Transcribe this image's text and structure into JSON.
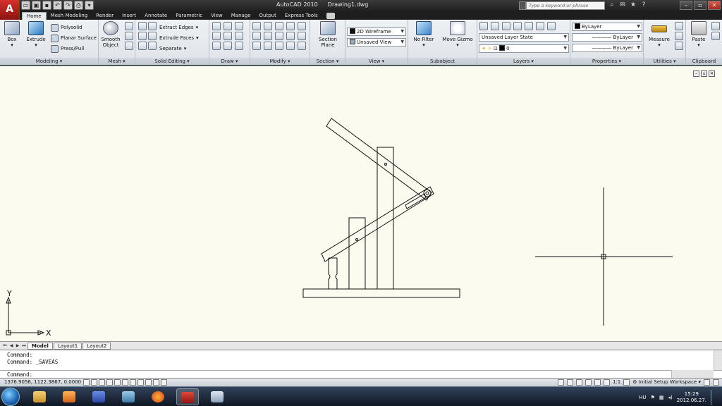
{
  "title": {
    "app_name": "AutoCAD 2010",
    "document": "Drawing1.dwg",
    "search_placeholder": "Type a keyword or phrase"
  },
  "tabs": [
    "Home",
    "Mesh Modeling",
    "Render",
    "Insert",
    "Annotate",
    "Parametric",
    "View",
    "Manage",
    "Output",
    "Express Tools"
  ],
  "ribbon": {
    "modeling": {
      "title": "Modeling",
      "box": "Box",
      "extrude": "Extrude",
      "polysolid": "Polysolid",
      "planar_surface": "Planar Surface",
      "press_pull": "Press/Pull"
    },
    "mesh": {
      "title": "Mesh",
      "smooth_object_1": "Smooth",
      "smooth_object_2": "Object"
    },
    "solid_editing": {
      "title": "Solid Editing",
      "extract_edges": "Extract Edges",
      "extrude_faces": "Extrude Faces",
      "separate": "Separate"
    },
    "draw": {
      "title": "Draw"
    },
    "modify": {
      "title": "Modify"
    },
    "section": {
      "title": "Section",
      "section_plane_1": "Section",
      "section_plane_2": "Plane"
    },
    "view": {
      "title": "View",
      "visual_style": "2D Wireframe",
      "named_view": "Unsaved View"
    },
    "subobject": {
      "title": "Subobject",
      "no_filter": "No Filter",
      "move_gizmo": "Move Gizmo"
    },
    "layers": {
      "title": "Layers",
      "layer_state": "Unsaved Layer State",
      "current_layer": "0"
    },
    "properties": {
      "title": "Properties",
      "color": "ByLayer",
      "linetype": "ByLayer",
      "lineweight": "ByLayer"
    },
    "utilities": {
      "title": "Utilities",
      "measure": "Measure"
    },
    "clipboard": {
      "title": "Clipboard",
      "paste": "Paste"
    }
  },
  "ucs": {
    "x": "X",
    "y": "Y"
  },
  "layout_tabs": [
    "Model",
    "Layout1",
    "Layout2"
  ],
  "command": {
    "history": [
      "Command:",
      "Command:  _SAVEAS"
    ],
    "prompt": "Command:"
  },
  "status": {
    "coordinates": "1376.9056, 1122.3867, 0.0000",
    "scale": "1:1",
    "workspace": "Initial Setup Workspace"
  },
  "taskbar": {
    "language": "HU",
    "time": "15:29",
    "date": "2012.06.27."
  }
}
